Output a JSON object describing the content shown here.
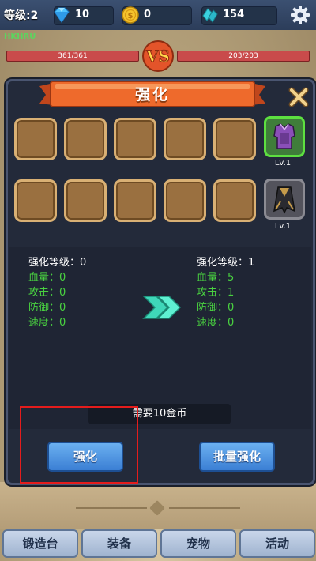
{
  "top_bar": {
    "level": "等级:2",
    "gems": "10",
    "gold": "0",
    "crystals": "154",
    "icons": [
      "diamond-icon",
      "gold-coin-icon",
      "crystal-icon",
      "gear-icon"
    ]
  },
  "battle": {
    "player_name": "HKHRU",
    "player_hp": "361/361",
    "enemy_hp": "203/203",
    "vs_icon": "vs-emblem"
  },
  "modal": {
    "title": "强化",
    "close_icon": "close-x-icon",
    "equipment": [
      {
        "icon": "purple-armor-icon",
        "level": "Lv.1",
        "selected": true
      },
      {
        "icon": "dark-cloak-icon",
        "level": "Lv.1",
        "selected": false
      }
    ],
    "current": {
      "level": "强化等级：0",
      "hp": "血量：0",
      "attack": "攻击：0",
      "defense": "防御：0",
      "speed": "速度：0"
    },
    "next": {
      "level": "强化等级：1",
      "hp": "血量：5",
      "attack": "攻击：1",
      "defense": "防御：0",
      "speed": "速度：0"
    },
    "cost": "需要10金币",
    "enhance_button": "强化",
    "batch_button": "批量强化"
  },
  "nav": {
    "forge": "锻造台",
    "equipment": "装备",
    "pet": "宠物",
    "activity": "活动"
  },
  "colors": {
    "stat_green": "#49d140",
    "button_blue": "#3b7fd4",
    "banner_orange": "#e8632a",
    "highlight_red": "#e41c1c"
  }
}
